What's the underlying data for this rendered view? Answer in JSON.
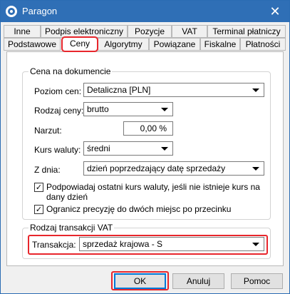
{
  "window": {
    "title": "Paragon",
    "close_glyph": "✕",
    "icon": "app-logo-icon"
  },
  "tabs_row1": [
    "Inne",
    "Podpis elektroniczny",
    "Pozycje",
    "VAT",
    "Terminal płatniczy"
  ],
  "tabs_row2": [
    "Podstawowe",
    "Ceny",
    "Algorytmy",
    "Powiązane",
    "Fiskalne",
    "Płatności"
  ],
  "active_tab": "Ceny",
  "price_group": {
    "title": "Cena na dokumencie",
    "price_level_label": "Poziom cen:",
    "price_level_value": "Detaliczna [PLN]",
    "price_type_label": "Rodzaj ceny:",
    "price_type_value": "brutto",
    "markup_label": "Narzut:",
    "markup_value": "0,00 %",
    "currency_rate_label": "Kurs waluty:",
    "currency_rate_value": "średni",
    "from_day_label": "Z dnia:",
    "from_day_value": "dzień poprzedzający datę sprzedaży",
    "suggest_rate_text_line1": "Podpowiadaj ostatni kurs waluty, jeśli nie istnieje kurs na",
    "suggest_rate_text_line2": "dany dzień",
    "suggest_rate_checked": true,
    "limit_precision_text": "Ogranicz precyzję do dwóch miejsc po przecinku",
    "limit_precision_checked": true
  },
  "vat_group": {
    "title": "Rodzaj transakcji VAT",
    "transaction_label": "Transakcja:",
    "transaction_value": "sprzedaż krajowa - S"
  },
  "buttons": {
    "ok": "OK",
    "cancel": "Anuluj",
    "help": "Pomoc"
  },
  "colors": {
    "titlebar": "#2f6fb6",
    "highlight": "#e8262c"
  }
}
